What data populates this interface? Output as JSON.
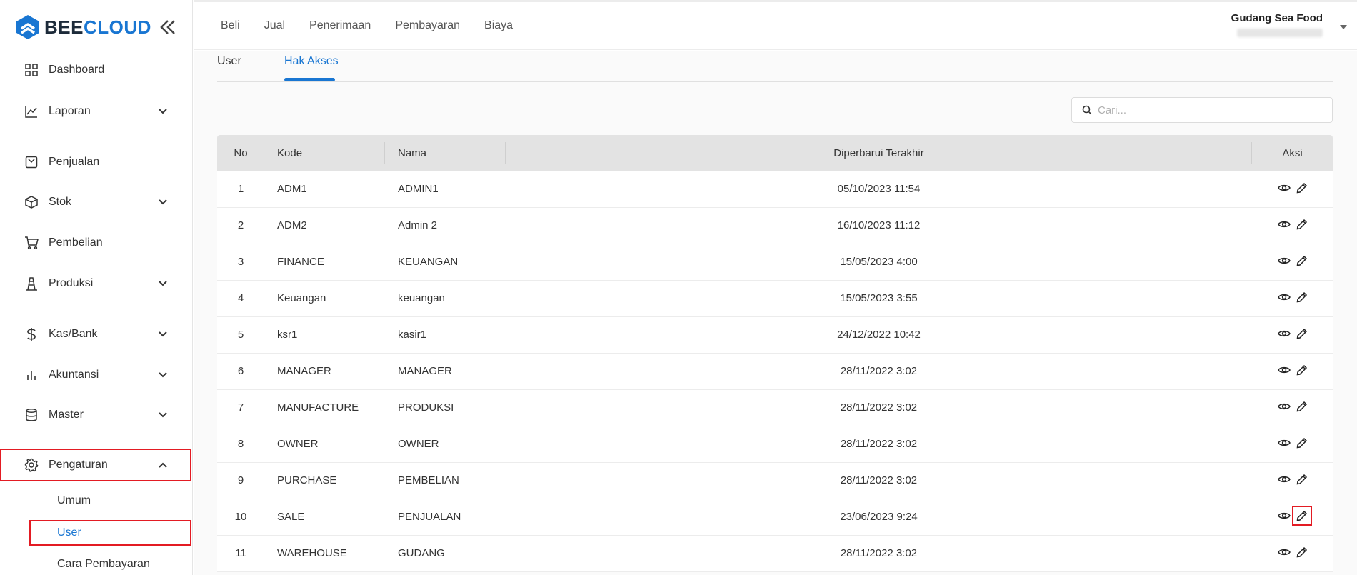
{
  "brand": {
    "part1": "BEE",
    "part2": "CLOUD",
    "color": "#1976d2"
  },
  "sidebar": {
    "items": [
      {
        "label": "Dashboard",
        "icon": "grid-icon"
      },
      {
        "label": "Laporan",
        "icon": "chart-line-icon"
      },
      {
        "label": "Penjualan",
        "icon": "sales-icon"
      },
      {
        "label": "Stok",
        "icon": "box-icon"
      },
      {
        "label": "Pembelian",
        "icon": "cart-icon"
      },
      {
        "label": "Produksi",
        "icon": "factory-icon"
      },
      {
        "label": "Kas/Bank",
        "icon": "dollar-icon"
      },
      {
        "label": "Akuntansi",
        "icon": "bar-chart-icon"
      },
      {
        "label": "Master",
        "icon": "database-icon"
      },
      {
        "label": "Pengaturan",
        "icon": "gear-icon"
      }
    ],
    "subitems": [
      {
        "label": "Umum"
      },
      {
        "label": "User"
      },
      {
        "label": "Cara Pembayaran"
      }
    ]
  },
  "topnav": [
    "Beli",
    "Jual",
    "Penerimaan",
    "Pembayaran",
    "Biaya"
  ],
  "company": {
    "name": "Gudang Sea Food"
  },
  "tabs": [
    "User",
    "Hak Akses"
  ],
  "search": {
    "placeholder": "Cari..."
  },
  "table": {
    "headers": [
      "No",
      "Kode",
      "Nama",
      "Diperbarui Terakhir",
      "Aksi"
    ],
    "rows": [
      {
        "no": "1",
        "kode": "ADM1",
        "nama": "ADMIN1",
        "date": "05/10/2023 11:54"
      },
      {
        "no": "2",
        "kode": "ADM2",
        "nama": "Admin 2",
        "date": "16/10/2023 11:12"
      },
      {
        "no": "3",
        "kode": "FINANCE",
        "nama": "KEUANGAN",
        "date": "15/05/2023 4:00"
      },
      {
        "no": "4",
        "kode": "Keuangan",
        "nama": "keuangan",
        "date": "15/05/2023 3:55"
      },
      {
        "no": "5",
        "kode": "ksr1",
        "nama": "kasir1",
        "date": "24/12/2022 10:42"
      },
      {
        "no": "6",
        "kode": "MANAGER",
        "nama": "MANAGER",
        "date": "28/11/2022 3:02"
      },
      {
        "no": "7",
        "kode": "MANUFACTURE",
        "nama": "PRODUKSI",
        "date": "28/11/2022 3:02"
      },
      {
        "no": "8",
        "kode": "OWNER",
        "nama": "OWNER",
        "date": "28/11/2022 3:02"
      },
      {
        "no": "9",
        "kode": "PURCHASE",
        "nama": "PEMBELIAN",
        "date": "28/11/2022 3:02"
      },
      {
        "no": "10",
        "kode": "SALE",
        "nama": "PENJUALAN",
        "date": "23/06/2023 9:24"
      },
      {
        "no": "11",
        "kode": "WAREHOUSE",
        "nama": "GUDANG",
        "date": "28/11/2022 3:02"
      }
    ]
  }
}
